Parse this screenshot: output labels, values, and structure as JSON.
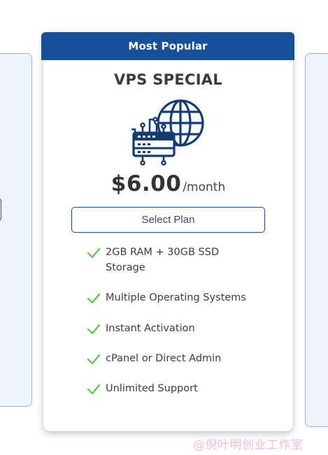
{
  "badge": {
    "label": "Most Popular"
  },
  "plan": {
    "name": "VPS SPECIAL",
    "icon": "server-globe-icon",
    "price": "$6.00",
    "period": "/month",
    "select_label": "Select Plan"
  },
  "features": [
    {
      "text": "2GB RAM + 30GB SSD Storage",
      "icon": "check-icon"
    },
    {
      "text": "Multiple Operating Systems",
      "icon": "check-icon"
    },
    {
      "text": "Instant Activation",
      "icon": "check-icon"
    },
    {
      "text": "cPanel or Direct Admin",
      "icon": "check-icon"
    },
    {
      "text": "Unlimited Support",
      "icon": "check-icon"
    }
  ],
  "watermark": "@倪叶明创业工作室",
  "colors": {
    "banner": "#16509a",
    "check": "#5cc24e",
    "icon": "#123d73",
    "side_card_bg": "#eef5fd",
    "side_card_border": "#8fb4de"
  }
}
